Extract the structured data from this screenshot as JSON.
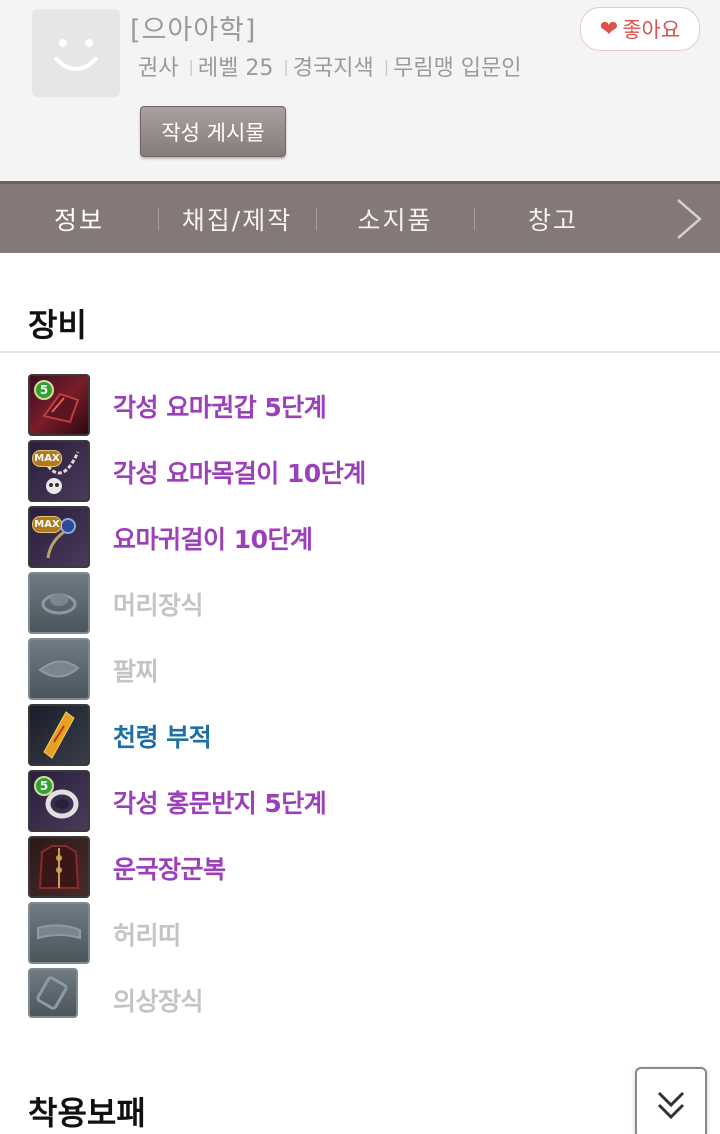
{
  "profile": {
    "char_name": "[으아아학]",
    "class": "권사",
    "level": "레벨 25",
    "server": "경국지색",
    "faction": "무림맹 입문인",
    "separator": "|",
    "like_label": "좋아요",
    "posts_label": "작성 게시물"
  },
  "tabs": [
    {
      "label": "정보",
      "active": true
    },
    {
      "label": "채집/제작",
      "active": false
    },
    {
      "label": "소지품",
      "active": false
    },
    {
      "label": "창고",
      "active": false
    }
  ],
  "equipment": {
    "title": "장비",
    "items": [
      {
        "name": "각성 요마권갑 5단계",
        "color": "#9b3fba",
        "badge": "5",
        "icon": "gauntlet-icon"
      },
      {
        "name": "각성 요마목걸이 10단계",
        "color": "#9b3fba",
        "badge": "MAX",
        "icon": "necklace-icon"
      },
      {
        "name": "요마귀걸이 10단계",
        "color": "#9b3fba",
        "badge": "MAX",
        "icon": "earring-icon"
      },
      {
        "name": "머리장식",
        "color": "#c4c4c4",
        "badge": "",
        "icon": "hat-placeholder-icon"
      },
      {
        "name": "팔찌",
        "color": "#c4c4c4",
        "badge": "",
        "icon": "bracelet-placeholder-icon"
      },
      {
        "name": "천령 부적",
        "color": "#1f6fa6",
        "badge": "",
        "icon": "talisman-icon"
      },
      {
        "name": "각성 홍문반지 5단계",
        "color": "#9b3fba",
        "badge": "5",
        "icon": "ring-icon"
      },
      {
        "name": "운국장군복",
        "color": "#9b3fba",
        "badge": "",
        "icon": "armor-icon"
      },
      {
        "name": "허리띠",
        "color": "#c4c4c4",
        "badge": "",
        "icon": "belt-placeholder-icon"
      },
      {
        "name": "의상장식",
        "color": "#c4c4c4",
        "badge": "",
        "icon": "costume-placeholder-icon"
      }
    ]
  },
  "soul_shield": {
    "title": "착용보패"
  },
  "colors": {
    "tab_bar": "#847878",
    "rare_item": "#9b3fba",
    "blue_item": "#1f6fa6",
    "empty_item": "#c4c4c4",
    "like": "#e0504a"
  }
}
